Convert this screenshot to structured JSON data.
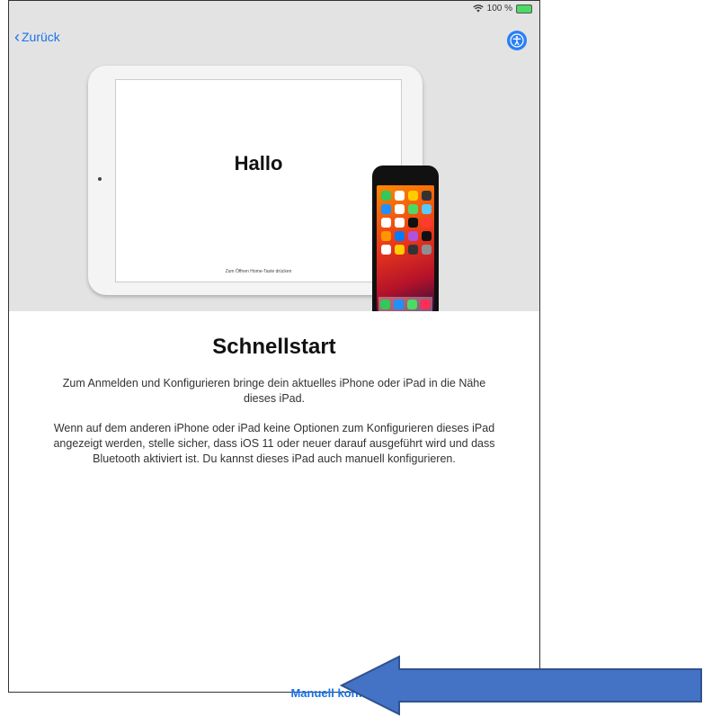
{
  "status": {
    "battery_percent": "100 %"
  },
  "nav": {
    "back_label": "Zurück"
  },
  "hero": {
    "ipad_greeting": "Hallo",
    "ipad_home_hint": "Zum Öffnen Home-Taste drücken"
  },
  "content": {
    "title": "Schnellstart",
    "para1": "Zum Anmelden und Konfigurieren bringe dein aktuelles iPhone oder iPad in die Nähe dieses iPad.",
    "para2": "Wenn auf dem anderen iPhone oder iPad keine Optionen zum Konfigurieren dieses iPad angezeigt werden, stelle sicher, dass iOS 11 oder neuer darauf ausgeführt wird und dass Bluetooth aktiviert ist. Du kannst dieses iPad auch manuell konfigurieren."
  },
  "footer": {
    "manual_label": "Manuell konfigurieren"
  },
  "colors": {
    "accent": "#1a73e8",
    "arrow": "#4472c4",
    "hero_bg": "#e3e3e4"
  },
  "icons": [
    "wifi-icon",
    "battery-icon",
    "chevron-left-icon",
    "accessibility-icon",
    "arrow-left-icon"
  ]
}
